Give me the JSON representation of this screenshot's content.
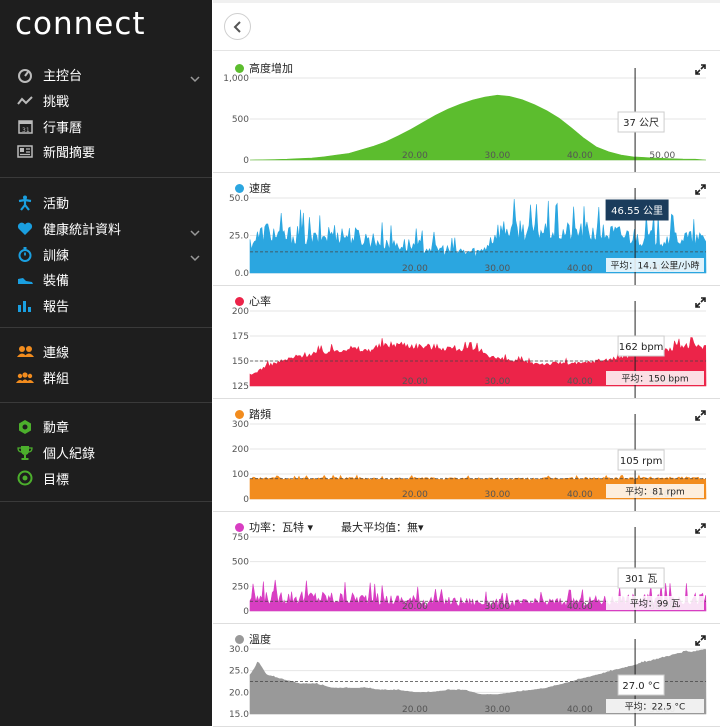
{
  "app": {
    "logo": "connect"
  },
  "sidebar": {
    "groups": [
      {
        "items": [
          {
            "label": "主控台",
            "icon": "dashboard-icon",
            "chevron": true
          },
          {
            "label": "挑戰",
            "icon": "challenge-icon",
            "chevron": false
          },
          {
            "label": "行事曆",
            "icon": "calendar-icon",
            "chevron": false
          },
          {
            "label": "新聞摘要",
            "icon": "newsfeed-icon",
            "chevron": false
          }
        ]
      },
      {
        "items": [
          {
            "label": "活動",
            "icon": "activity-icon",
            "chevron": false
          },
          {
            "label": "健康統計資料",
            "icon": "heart-icon",
            "chevron": true
          },
          {
            "label": "訓練",
            "icon": "stopwatch-icon",
            "chevron": true
          },
          {
            "label": "裝備",
            "icon": "shoe-icon",
            "chevron": false
          },
          {
            "label": "報告",
            "icon": "bar-chart-icon",
            "chevron": false
          }
        ]
      },
      {
        "items": [
          {
            "label": "連線",
            "icon": "connections-icon",
            "chevron": false
          },
          {
            "label": "群組",
            "icon": "groups-icon",
            "chevron": false
          }
        ]
      },
      {
        "items": [
          {
            "label": "勳章",
            "icon": "badge-icon",
            "chevron": false
          },
          {
            "label": "個人紀錄",
            "icon": "trophy-icon",
            "chevron": false
          },
          {
            "label": "目標",
            "icon": "target-icon",
            "chevron": false
          }
        ]
      }
    ]
  },
  "toolbar": {
    "back_icon": "chevron-left-icon"
  },
  "colors": {
    "sidebar_bg": "#1e1e1e",
    "sidebar_icon": "#1a9fe0",
    "elevation": "#5cbd2e",
    "speed": "#2ba6e0",
    "heart_rate": "#ec2449",
    "cadence": "#f28c1e",
    "power": "#d83ec2",
    "temperature": "#999999"
  },
  "chart_data": [
    {
      "id": "elevation",
      "type": "area",
      "title": "高度增加",
      "color": "#5cbd2e",
      "x_ticks": [
        "20.00",
        "30.00",
        "40.00",
        "50.00"
      ],
      "x_tick_values": [
        20,
        30,
        40,
        50
      ],
      "y_ticks": [
        "0",
        "500",
        "1,000"
      ],
      "y_tick_values": [
        0,
        500,
        1000
      ],
      "ylim": [
        0,
        1000
      ],
      "xlim": [
        0,
        55.3
      ],
      "x": [
        0,
        4,
        8,
        12,
        16,
        18,
        20,
        22,
        24,
        26,
        28,
        30,
        32,
        34,
        36,
        38,
        40,
        42,
        44,
        46,
        48,
        50,
        52,
        55.3
      ],
      "y": [
        0,
        8,
        25,
        80,
        200,
        295,
        400,
        520,
        620,
        700,
        760,
        790,
        770,
        700,
        600,
        480,
        300,
        160,
        80,
        40,
        30,
        20,
        12,
        8
      ],
      "cursor_x": 46.7,
      "tooltip": "37 公尺",
      "average_line": null,
      "average_label": ""
    },
    {
      "id": "speed",
      "type": "area",
      "title": "速度",
      "color": "#2ba6e0",
      "x_ticks": [
        "20.00",
        "30.00",
        "40.00",
        "50.00"
      ],
      "x_tick_values": [
        20,
        30,
        40,
        50
      ],
      "y_ticks": [
        "0.0",
        "25.0",
        "50.0"
      ],
      "y_tick_values": [
        0,
        25,
        50
      ],
      "ylim": [
        0,
        50
      ],
      "xlim": [
        0,
        55.3
      ],
      "x": [
        0,
        2,
        4,
        6,
        8,
        10,
        12,
        14,
        16,
        18,
        20,
        22,
        24,
        26,
        28,
        30,
        32,
        34,
        36,
        38,
        40,
        42,
        44,
        46,
        48,
        50,
        52,
        54,
        55.3
      ],
      "y": [
        20,
        28,
        24,
        26,
        22,
        27,
        25,
        23,
        21,
        19,
        18,
        17,
        15,
        14,
        14,
        28,
        30,
        28,
        29,
        27,
        28,
        27,
        26,
        25,
        24,
        23,
        24,
        22,
        22
      ],
      "cursor_x": 46.7,
      "tooltip": "46.55 公里",
      "average_line": 14.1,
      "average_label": "平均：14.1 公里/小時"
    },
    {
      "id": "heart_rate",
      "type": "area",
      "title": "心率",
      "color": "#ec2449",
      "x_ticks": [
        "20.00",
        "30.00",
        "40.00",
        "50.00"
      ],
      "x_tick_values": [
        20,
        30,
        40,
        50
      ],
      "y_ticks": [
        "125",
        "150",
        "175",
        "200"
      ],
      "y_tick_values": [
        125,
        150,
        175,
        200
      ],
      "ylim": [
        125,
        200
      ],
      "xlim": [
        0,
        55.3
      ],
      "x": [
        0,
        2,
        4,
        6,
        8,
        10,
        12,
        14,
        16,
        18,
        20,
        22,
        24,
        26,
        28,
        30,
        32,
        34,
        36,
        38,
        40,
        42,
        44,
        46,
        48,
        50,
        52,
        54,
        55.3
      ],
      "y": [
        135,
        145,
        150,
        155,
        158,
        160,
        163,
        160,
        165,
        167,
        165,
        164,
        163,
        162,
        160,
        152,
        150,
        148,
        147,
        148,
        147,
        150,
        152,
        155,
        158,
        160,
        164,
        166,
        163
      ],
      "cursor_x": 46.7,
      "tooltip": "162 bpm",
      "average_line": 150,
      "average_label": "平均：150 bpm"
    },
    {
      "id": "cadence",
      "type": "area",
      "title": "踏頻",
      "color": "#f28c1e",
      "x_ticks": [
        "20.00",
        "30.00",
        "40.00",
        "50.00"
      ],
      "x_tick_values": [
        20,
        30,
        40,
        50
      ],
      "y_ticks": [
        "0",
        "100",
        "200",
        "300"
      ],
      "y_tick_values": [
        0,
        100,
        200,
        300
      ],
      "ylim": [
        0,
        300
      ],
      "xlim": [
        0,
        55.3
      ],
      "x": [
        0,
        4,
        8,
        12,
        16,
        20,
        24,
        28,
        32,
        36,
        40,
        44,
        48,
        52,
        55.3
      ],
      "y": [
        85,
        80,
        82,
        84,
        80,
        83,
        81,
        82,
        80,
        82,
        83,
        82,
        84,
        85,
        83
      ],
      "cursor_x": 46.7,
      "tooltip": "105 rpm",
      "average_line": 81,
      "average_label": "平均：81 rpm"
    },
    {
      "id": "power",
      "type": "area",
      "title": "功率：瓦特 ▾",
      "extra": "最大平均值：無▾",
      "color": "#d83ec2",
      "x_ticks": [
        "20.00",
        "30.00",
        "40.00",
        "50.00"
      ],
      "x_tick_values": [
        20,
        30,
        40,
        50
      ],
      "y_ticks": [
        "0",
        "250",
        "500",
        "750"
      ],
      "y_tick_values": [
        0,
        250,
        500,
        750
      ],
      "ylim": [
        0,
        750
      ],
      "xlim": [
        0,
        55.3
      ],
      "x": [
        0,
        4,
        8,
        12,
        16,
        20,
        24,
        28,
        32,
        36,
        40,
        44,
        48,
        52,
        55.3
      ],
      "y": [
        120,
        150,
        140,
        130,
        120,
        110,
        100,
        90,
        80,
        90,
        100,
        110,
        120,
        130,
        125
      ],
      "cursor_x": 46.7,
      "tooltip": "301 瓦",
      "average_line": 99,
      "average_label": "平均：99 瓦"
    },
    {
      "id": "temperature",
      "type": "area",
      "title": "溫度",
      "color": "#999999",
      "x_ticks": [
        "20.00",
        "30.00",
        "40.00",
        "50.00"
      ],
      "x_tick_values": [
        20,
        30,
        40,
        50
      ],
      "y_ticks": [
        "15.0",
        "20.0",
        "25.0",
        "30.0"
      ],
      "y_tick_values": [
        15,
        20,
        25,
        30
      ],
      "ylim": [
        15,
        30
      ],
      "xlim": [
        0,
        55.3
      ],
      "x": [
        0,
        1,
        2,
        4,
        6,
        8,
        10,
        12,
        14,
        16,
        18,
        20,
        22,
        24,
        26,
        28,
        30,
        32,
        34,
        36,
        38,
        40,
        42,
        44,
        46,
        48,
        50,
        52,
        54,
        55.3
      ],
      "y": [
        24,
        27,
        24,
        23,
        22,
        22,
        21,
        21,
        21,
        20.5,
        20.5,
        20,
        20,
        20.5,
        20.5,
        19.5,
        19.5,
        20,
        20.5,
        21,
        22,
        23,
        24,
        25,
        26,
        27,
        28,
        29,
        29.5,
        30
      ],
      "cursor_x": 46.7,
      "tooltip": "27.0 °C",
      "average_line": 22.5,
      "average_label": "平均：22.5 °C"
    }
  ]
}
